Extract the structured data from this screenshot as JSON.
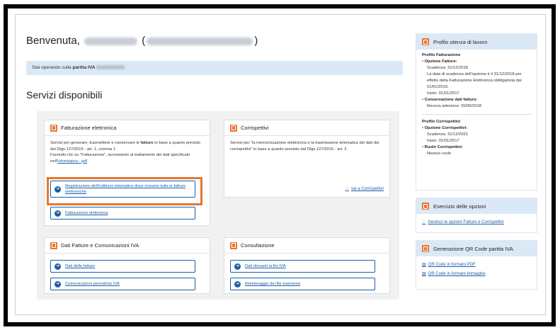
{
  "header": {
    "welcome_prefix": "Benvenuta,",
    "welcome_paren_open": "(",
    "welcome_paren_close": ")"
  },
  "vat": {
    "prefix": "Stai operando sulla",
    "label": "partita IVA"
  },
  "services": {
    "title": "Servizi disponibili",
    "fatturazione": {
      "title": "Fatturazione elettronica",
      "desc1": "Servizi per generare, trasmettere e conservare le ",
      "desc_bold": "fatture",
      "desc2": " in base a quanto previsto dal Dlgs.127/2015 - art. 1, comma 1",
      "desc3": "Facendo clic su \"Fatturazione\", acconsento al trattamento dei dati specificato nell'",
      "informativa": "Informativa - pdf",
      "btn_registrazione": "Registrazione dell'indirizzo telematico dove ricevere tutte le fatture elettroniche",
      "btn_fatturazione": "Fatturazione elettronica"
    },
    "corrispettivi": {
      "title": "Corrispettivi",
      "desc": "Servizi per \"la memorizzazione elettronica e la trasmissione telematica dei dati dei corrispettivi\" in base a quanto previsto dal Dlgs.127/2015 - art. 2.",
      "link": "vai a Corrispettivi"
    },
    "dati_fatture": {
      "title": "Dati Fatture e Comunicazioni IVA",
      "btn1": "Dati delle fatture",
      "btn2": "Comunicazioni periodiche IVA"
    },
    "consultazione": {
      "title": "Consultazione",
      "btn1": "Dati rilevanti ai fini IVA",
      "btn2": "Monitoraggio dei file trasmessi"
    }
  },
  "sidebar": {
    "profilo": {
      "title": "Profilo utenza di lavoro",
      "fatt_title": "Profilo Fatturazione",
      "opzione_fatture": "Opzione Fatture:",
      "scadenza1": "Scadenza: 31/12/2018",
      "nota": "La data di scadenza dell'opzione è il 31/12/2018 per effetto della Fatturazione Elettronica obbligatoria dal 01/01/2019.",
      "inizio1": "Inizio: 01/01/2017",
      "conservazione": "Conservazione dati fatture:",
      "revoca": "Revoca adesione: 25/05/2018",
      "corr_title": "Profilo Corrispettivi",
      "opzione_corr": "Opzione Corrispettivi:",
      "scadenza2": "Scadenza: 31/12/2021",
      "inizio2": "Inizio: 01/01/2017",
      "ruolo": "Ruolo Corrispettivi:",
      "nessun_ruolo": "Nessun ruolo"
    },
    "esercizio": {
      "title": "Esercizio delle opzioni",
      "link": "Gestisci le opzioni Fatture e Corrispettivi"
    },
    "qr": {
      "title": "Generazione QR Code partita IVA",
      "link_pdf": "QR Code in formato PDF",
      "link_img": "QR Code in formato immagine"
    }
  },
  "colors": {
    "accent": "#e8772e",
    "link": "#1a5fa8",
    "side_bg": "#dbe9f6"
  }
}
